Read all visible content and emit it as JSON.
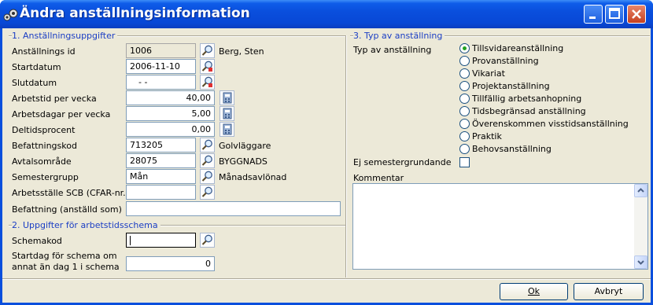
{
  "window": {
    "title": "Ändra anställningsinformation"
  },
  "section1": {
    "title": "1. Anställningsuppgifter",
    "rows": [
      {
        "label": "Anställnings id",
        "value": "1006",
        "extra": "Berg, Sten"
      },
      {
        "label": "Startdatum",
        "value": "2006-11-10",
        "extra": ""
      },
      {
        "label": "Slutdatum",
        "value": "- -",
        "extra": ""
      },
      {
        "label": "Arbetstid per vecka",
        "value": "40,00",
        "extra": ""
      },
      {
        "label": "Arbetsdagar per vecka",
        "value": "5,00",
        "extra": ""
      },
      {
        "label": "Deltidsprocent",
        "value": "0,00",
        "extra": ""
      },
      {
        "label": "Befattningskod",
        "value": "713205",
        "extra": "Golvläggare"
      },
      {
        "label": "Avtalsområde",
        "value": "28075",
        "extra": "BYGGNADS"
      },
      {
        "label": "Semestergrupp",
        "value": "Mån",
        "extra": "Månadsavlönad"
      },
      {
        "label": "Arbetsställe SCB (CFAR-nr.)",
        "value": "",
        "extra": ""
      },
      {
        "label": "Befattning (anställd som)",
        "value": "",
        "extra": ""
      }
    ]
  },
  "section2": {
    "title": "2. Uppgifter för arbetstidsschema",
    "schemakod_label": "Schemakod",
    "schemakod_value": "",
    "startdag_label_1": "Startdag för schema om",
    "startdag_label_2": "annat än dag 1 i schema",
    "startdag_value": "0"
  },
  "section3": {
    "title": "3. Typ av anställning",
    "typ_label": "Typ av anställning",
    "options": [
      {
        "label": "Tillsvidareanställning",
        "selected": true
      },
      {
        "label": "Provanställning",
        "selected": false
      },
      {
        "label": "Vikariat",
        "selected": false
      },
      {
        "label": "Projektanställning",
        "selected": false
      },
      {
        "label": "Tillfällig arbetsanhopning",
        "selected": false
      },
      {
        "label": "Tidsbegränsad anställning",
        "selected": false
      },
      {
        "label": "Överenskommen visstidsanställning",
        "selected": false
      },
      {
        "label": "Praktik",
        "selected": false
      },
      {
        "label": "Behovsanställning",
        "selected": false
      }
    ],
    "ej_semester_label": "Ej semestergrundande",
    "ej_semester_checked": false,
    "kommentar_label": "Kommentar",
    "kommentar_value": ""
  },
  "buttons": {
    "ok": "Ok",
    "cancel": "Avbryt"
  },
  "colors": {
    "titlebar": "#0a4fdd",
    "section_title": "#1b3ec4",
    "dialog_bg": "#ece9d8"
  }
}
